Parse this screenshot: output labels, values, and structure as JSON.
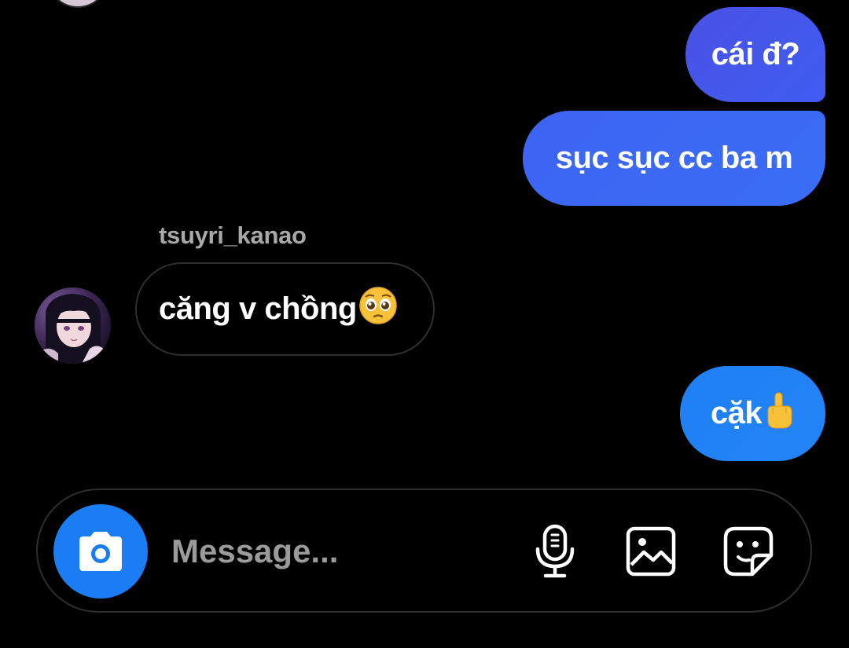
{
  "colors": {
    "background": "#000000",
    "outgoing_bubble_top": "#4a52e6",
    "outgoing_bubble_mid": "#3d63f3",
    "outgoing_bubble_bottom": "#1f7ff5",
    "camera_button": "#1b7df4",
    "sender_name": "#a8a8a8",
    "placeholder": "#9b9b9b"
  },
  "messages": [
    {
      "direction": "outgoing",
      "text": "cái đ?"
    },
    {
      "direction": "outgoing",
      "text": "sục sục cc ba m"
    },
    {
      "direction": "incoming",
      "sender": "tsuyri_kanao",
      "text": "căng v chồng",
      "emoji": "🥺",
      "avatar_icon": "user-avatar"
    },
    {
      "direction": "outgoing",
      "text": "cặk",
      "emoji": "🖕"
    }
  ],
  "composer": {
    "placeholder": "Message...",
    "value": "",
    "camera_icon": "camera-icon",
    "mic_icon": "microphone-icon",
    "gallery_icon": "gallery-icon",
    "sticker_icon": "sticker-icon"
  }
}
